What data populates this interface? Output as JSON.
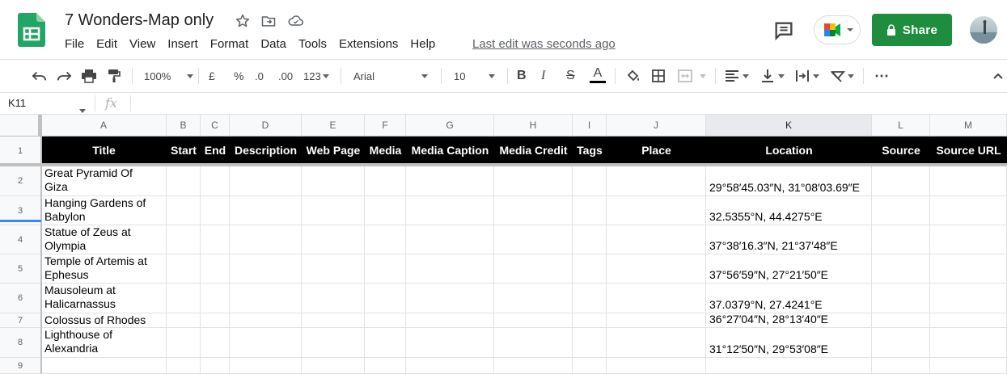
{
  "app": {
    "doc_title": "7 Wonders-Map only",
    "last_edit": "Last edit was seconds ago",
    "share_label": "Share",
    "brand_color": "#1e8e3e"
  },
  "menu": [
    "File",
    "Edit",
    "View",
    "Insert",
    "Format",
    "Data",
    "Tools",
    "Extensions",
    "Help"
  ],
  "toolbar": {
    "zoom": "100%",
    "currency": "£",
    "percent": "%",
    "dec_decrease": ".0",
    "dec_increase": ".00",
    "more_formats": "123",
    "font": "Arial",
    "font_size": "10",
    "bold": "B",
    "italic": "I",
    "strike": "S",
    "text_color": "A",
    "more": "⋯"
  },
  "formula_bar": {
    "name_box": "K11",
    "fx": "fx"
  },
  "grid": {
    "columns": [
      "A",
      "B",
      "C",
      "D",
      "E",
      "F",
      "G",
      "H",
      "I",
      "J",
      "K",
      "L",
      "M"
    ],
    "selected_column": "K",
    "header_row": [
      "Title",
      "Start",
      "End",
      "Description",
      "Web Page",
      "Media",
      "Media Caption",
      "Media Credit",
      "Tags",
      "Place",
      "Location",
      "Source",
      "Source URL"
    ],
    "row_numbers": [
      "1",
      "2",
      "3",
      "4",
      "5",
      "6",
      "7",
      "8",
      "9"
    ],
    "rows": [
      {
        "title_1": "Great Pyramid Of",
        "title_2": "Giza",
        "location": "29°58′45.03″N, 31°08′03.69″E"
      },
      {
        "title_1": "Hanging Gardens of",
        "title_2": "Babylon",
        "location": "32.5355°N, 44.4275°E"
      },
      {
        "title_1": "Statue of Zeus at",
        "title_2": "Olympia",
        "location": "37°38′16.3″N, 21°37′48″E"
      },
      {
        "title_1": "Temple of Artemis at",
        "title_2": "Ephesus",
        "location": "37°56′59″N, 27°21′50″E"
      },
      {
        "title_1": "Mausoleum at",
        "title_2": "Halicarnassus",
        "location": "37.0379°N, 27.4241°E"
      },
      {
        "title_1": "Colossus of Rhodes",
        "title_2": "",
        "location": "36°27′04″N, 28°13′40″E"
      },
      {
        "title_1": "Lighthouse of",
        "title_2": "Alexandria",
        "location": "31°12′50″N, 29°53′08″E"
      }
    ]
  }
}
